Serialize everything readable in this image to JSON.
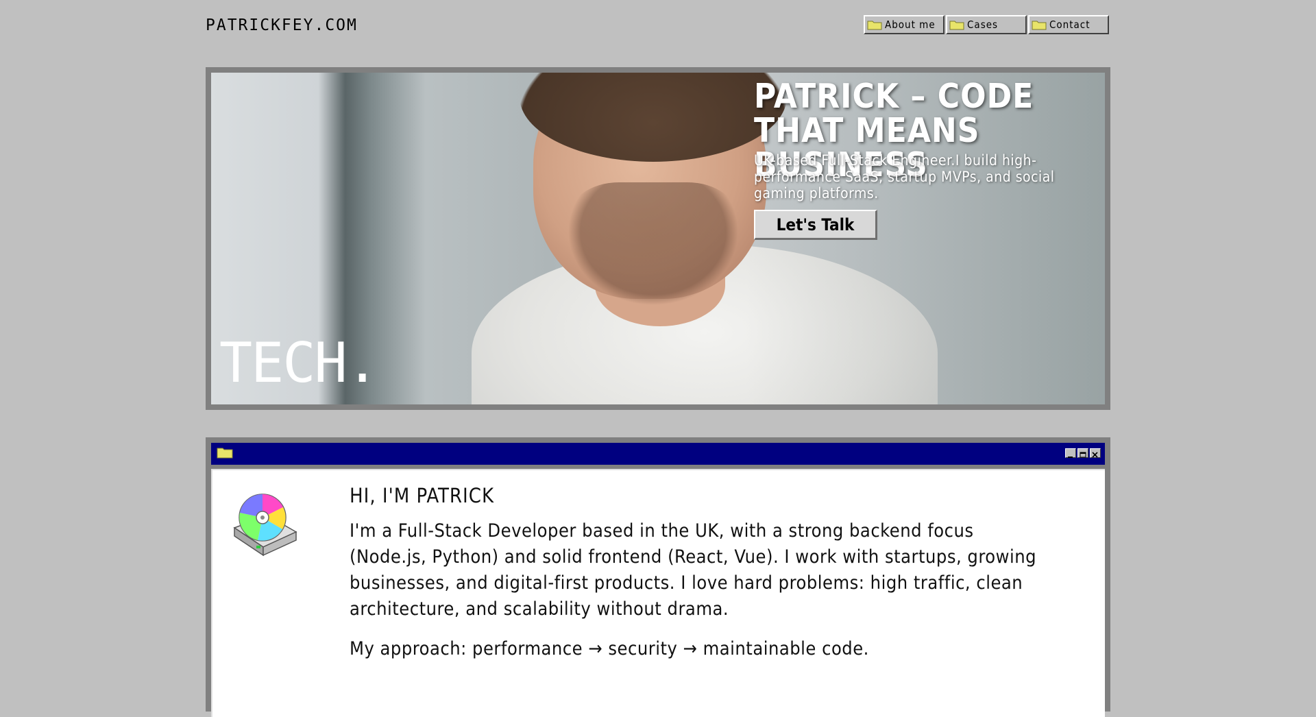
{
  "header": {
    "logo": "PATRICKFEY.COM"
  },
  "nav": {
    "items": [
      {
        "label": "About me",
        "icon": "folder-icon"
      },
      {
        "label": "Cases",
        "icon": "folder-icon"
      },
      {
        "label": "Contact",
        "icon": "folder-icon"
      }
    ]
  },
  "hero": {
    "title": "PATRICK – CODE THAT MEANS BUSINESS",
    "subtitle": "UK-based Full-Stack Engineer.I build high-performance SaaS, startup MVPs, and social gaming platforms.",
    "cta_label": "Let's Talk",
    "overlay_word": "TECH."
  },
  "window": {
    "title_icon": "folder-icon",
    "controls": [
      "minimize-icon",
      "maximize-icon",
      "close-icon"
    ],
    "heading": "HI, I'M PATRICK",
    "paragraphs": [
      "I'm a Full-Stack Developer based in the UK, with a strong backend focus (Node.js, Python) and solid frontend (React, Vue). I work with startups, growing businesses, and digital-first products. I love hard problems: high traffic, clean architecture, and scalability without drama.",
      "My approach: performance → security → maintainable code."
    ]
  },
  "colors": {
    "background": "#c0c0c0",
    "titlebar": "#000080",
    "folder": "#e8e46a"
  }
}
